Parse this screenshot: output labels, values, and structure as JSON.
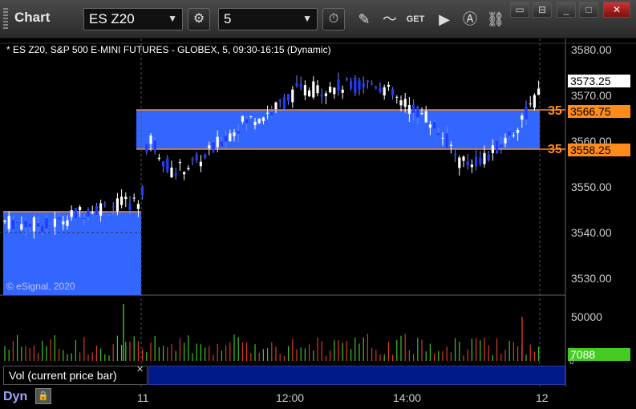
{
  "window": {
    "title": "Chart",
    "symbol": "ES Z20",
    "interval": "5"
  },
  "chart": {
    "header": "* ES Z20, S&P 500 E-MINI FUTURES - GLOBEX, 5, 09:30-16:15 (Dynamic)",
    "copyright": "© eSignal, 2020",
    "last_price": "3573.25",
    "upper_level": "3566.75",
    "lower_level": "3558.25",
    "upper_level_count": "35",
    "lower_level_count": "35",
    "volume_value": "7088",
    "volume_label": "Vol (current price bar)",
    "dyn_label": "Dyn",
    "colors": {
      "zone": "#3366ff",
      "level_line": "#ff8c1a",
      "up_bar": "#ffffff",
      "down_bar": "#1e3cff",
      "last_price_bg": "#ffffff",
      "volume_tag_bg": "#44cc22"
    }
  },
  "chart_data": {
    "type": "candlestick",
    "y_axis": {
      "ticks": [
        "3580.00",
        "3570.00",
        "3560.00",
        "3550.00",
        "3540.00",
        "3530.00"
      ],
      "range": [
        3527,
        3583
      ]
    },
    "x_axis": {
      "ticks": [
        "11",
        "12:00",
        "14:00",
        "12"
      ]
    },
    "volume_axis": {
      "ticks": [
        "50000",
        "0"
      ]
    },
    "price_levels": [
      3566.75,
      3558.25
    ],
    "prior_zone_top": 3544.5,
    "last_price": 3573.25
  }
}
